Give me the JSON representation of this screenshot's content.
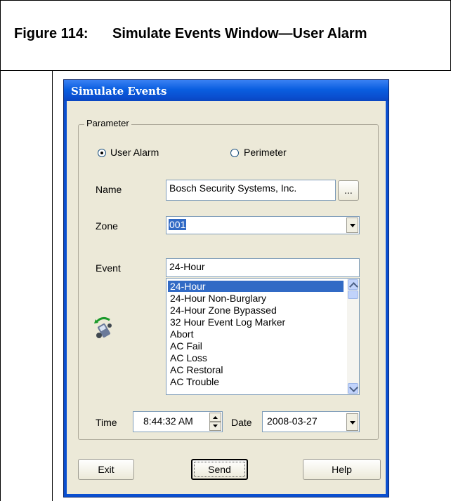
{
  "figure": {
    "number": "Figure 114:",
    "title": "Simulate Events Window—User Alarm"
  },
  "window": {
    "title": "Simulate Events"
  },
  "parameter_group": {
    "label": "Parameter",
    "radio_user_alarm": "User Alarm",
    "radio_perimeter": "Perimeter",
    "selected": "User Alarm"
  },
  "name_field": {
    "label": "Name",
    "value": "Bosch Security Systems, Inc.",
    "browse_label": "..."
  },
  "zone_field": {
    "label": "Zone",
    "value": "001"
  },
  "event_field": {
    "label": "Event",
    "value": "24-Hour",
    "list": [
      "24-Hour",
      "24-Hour Non-Burglary",
      "24-Hour Zone Bypassed",
      "32 Hour Event Log Marker",
      "Abort",
      "AC Fail",
      "AC Loss",
      "AC Restoral",
      "AC Trouble"
    ],
    "selected_index": 0
  },
  "icon": "phone-transfer-icon",
  "time_field": {
    "label": "Time",
    "value": "8:44:32 AM"
  },
  "date_field": {
    "label": "Date",
    "value": "2008-03-27"
  },
  "buttons": {
    "exit": "Exit",
    "send": "Send",
    "help": "Help"
  },
  "colors": {
    "title_bar": "#0a4fd0",
    "selection": "#316ac5",
    "window_bg": "#ece9d8"
  }
}
